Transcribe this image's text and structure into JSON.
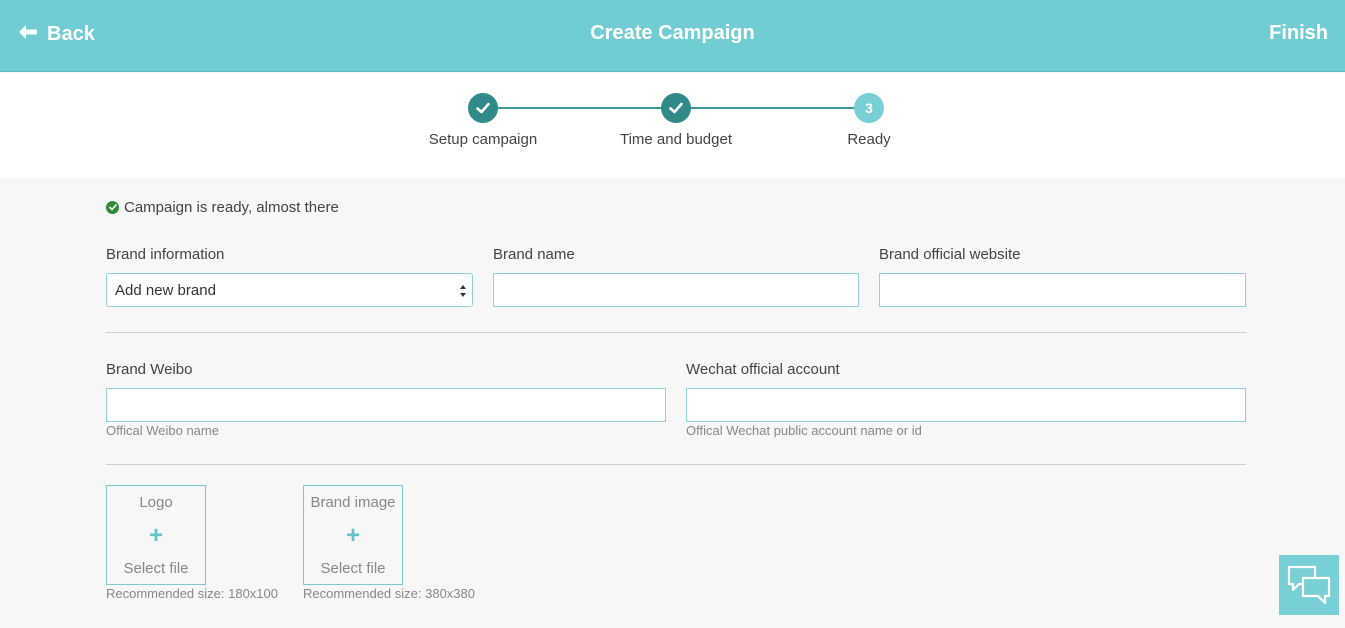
{
  "header": {
    "back_label": "Back",
    "title": "Create Campaign",
    "finish_label": "Finish"
  },
  "steps": [
    {
      "label": "Setup campaign",
      "state": "done",
      "icon": "check-icon"
    },
    {
      "label": "Time and budget",
      "state": "done",
      "icon": "check-icon"
    },
    {
      "label": "Ready",
      "state": "current",
      "number": "3"
    }
  ],
  "status": {
    "message": "Campaign is ready, almost there",
    "icon": "check-circle-icon"
  },
  "form": {
    "brand_information": {
      "label": "Brand information",
      "selected": "Add new brand"
    },
    "brand_name": {
      "label": "Brand name",
      "value": ""
    },
    "brand_website": {
      "label": "Brand official website",
      "value": ""
    },
    "brand_weibo": {
      "label": "Brand Weibo",
      "value": "",
      "hint": "Offical Weibo name"
    },
    "wechat_account": {
      "label": "Wechat official account",
      "value": "",
      "hint": "Offical Wechat public account name or id"
    }
  },
  "uploads": {
    "logo": {
      "title": "Logo",
      "plus": "+",
      "select_label": "Select file",
      "recommended": "Recommended size: 180x100"
    },
    "brand_image": {
      "title": "Brand image",
      "plus": "+",
      "select_label": "Select file",
      "recommended": "Recommended size: 380x380"
    }
  },
  "colors": {
    "header_bg": "#71ccd3",
    "step_done": "#2f8a88",
    "step_current": "#78cfd6",
    "input_border": "#8fd3d8",
    "status_ok": "#2f8a3a"
  },
  "chat": {
    "icon": "chat-bubbles-icon"
  }
}
